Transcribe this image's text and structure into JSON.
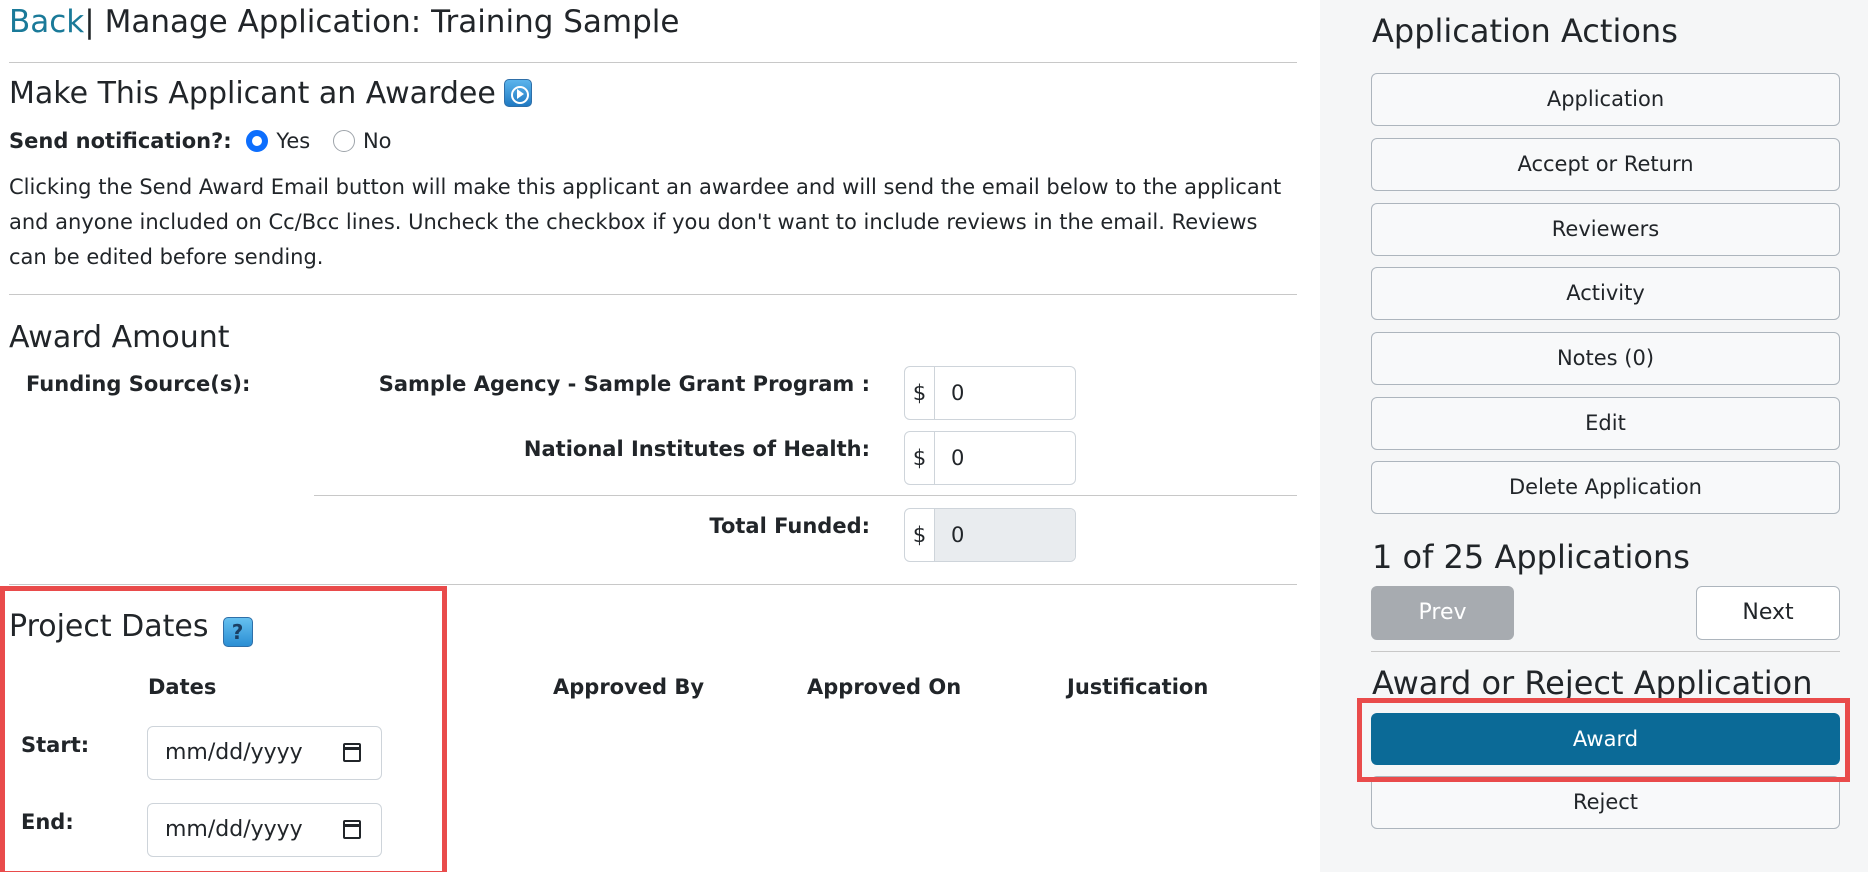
{
  "header": {
    "back_label": "Back",
    "separator": "|",
    "title": "Manage Application: Training Sample"
  },
  "awardee_section": {
    "title": "Make This Applicant an Awardee",
    "notify_label": "Send notification?:",
    "notify_options": [
      {
        "label": "Yes",
        "selected": true
      },
      {
        "label": "No",
        "selected": false
      }
    ],
    "description": "Clicking the Send Award Email button will make this applicant an awardee and will send the email below to the applicant and anyone included on Cc/Bcc lines. Uncheck the checkbox if you don't want to include reviews in the email. Reviews can be edited before sending."
  },
  "award_amount": {
    "title": "Award Amount",
    "funding_label": "Funding Source(s):",
    "currency_symbol": "$",
    "sources": [
      {
        "name": "Sample Agency - Sample Grant Program :",
        "value": "0"
      },
      {
        "name": "National Institutes of Health:",
        "value": "0"
      }
    ],
    "total_label": "Total Funded:",
    "total_value": "0"
  },
  "project_dates": {
    "title": "Project Dates",
    "help_glyph": "?",
    "columns": [
      "Dates",
      "Approved By",
      "Approved On",
      "Justification"
    ],
    "start_label": "Start:",
    "end_label": "End:",
    "date_placeholder": "mm/dd/yyyy"
  },
  "sidebar": {
    "actions_title": "Application Actions",
    "actions": [
      "Application",
      "Accept or Return",
      "Reviewers",
      "Activity",
      "Notes (0)",
      "Edit",
      "Delete Application"
    ],
    "pager_title": "1 of 25 Applications",
    "prev_label": "Prev",
    "next_label": "Next",
    "decision_title": "Award or Reject Application",
    "award_label": "Award",
    "reject_label": "Reject"
  },
  "colors": {
    "link": "#1a7a99",
    "award_button": "#0b6a97",
    "highlight": "#e94b4b",
    "radio_selected": "#0d6efd"
  }
}
